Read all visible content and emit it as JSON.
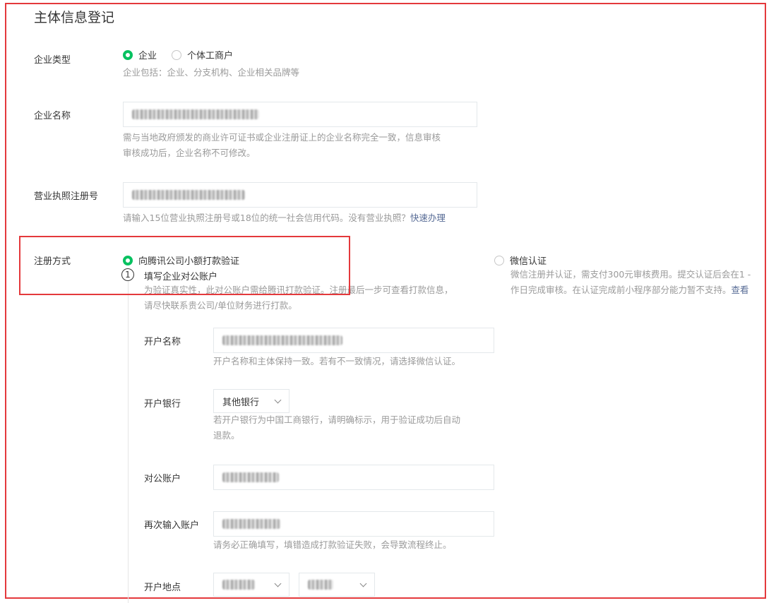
{
  "page": {
    "title": "主体信息登记"
  },
  "enterprise_type": {
    "label": "企业类型",
    "options": [
      {
        "label": "企业",
        "selected": true
      },
      {
        "label": "个体工商户",
        "selected": false
      }
    ],
    "tip": "企业包括：企业、分支机构、企业相关品牌等"
  },
  "enterprise_name": {
    "label": "企业名称",
    "tip_line1": "需与当地政府颁发的商业许可证书或企业注册证上的企业名称完全一致，信息审核",
    "tip_line2": "审核成功后，企业名称不可修改。"
  },
  "license": {
    "label": "营业执照注册号",
    "tip": "请输入15位营业执照注册号或18位的统一社会信用代码。没有营业执照？",
    "link": "快速办理"
  },
  "register_method": {
    "label": "注册方式",
    "option_transfer": "向腾讯公司小额打款验证",
    "option_wechat": "微信认证",
    "wechat_tip_line1": "微信注册并认证，需支付300元审核费用。提交认证后会在1 -",
    "wechat_tip_line2": "作日完成审核。在认证完成前小程序部分能力暂不支持。",
    "wechat_link": "查看",
    "step_number": "1",
    "step_title": "填写企业对公账户",
    "step_tip_line1": "为验证真实性，此对公账户需给腾讯打款验证。注册最后一步可查看打款信息，",
    "step_tip_line2": "请尽快联系贵公司/单位财务进行打款。"
  },
  "bank_form": {
    "account_name": {
      "label": "开户名称",
      "tip": "开户名称和主体保持一致。若有不一致情况，请选择微信认证。"
    },
    "bank": {
      "label": "开户银行",
      "selected": "其他银行",
      "tip_line1": "若开户银行为中国工商银行，请明确标示，用于验证成功后自动",
      "tip_line2": "退款。"
    },
    "account": {
      "label": "对公账户"
    },
    "account_confirm": {
      "label": "再次输入账户",
      "tip": "请务必正确填写，填错造成打款验证失败，会导致流程终止。"
    },
    "location": {
      "label": "开户地点"
    }
  },
  "colors": {
    "accent_green": "#07c160",
    "link_blue": "#576b95",
    "annotation_red": "#e4393c"
  }
}
